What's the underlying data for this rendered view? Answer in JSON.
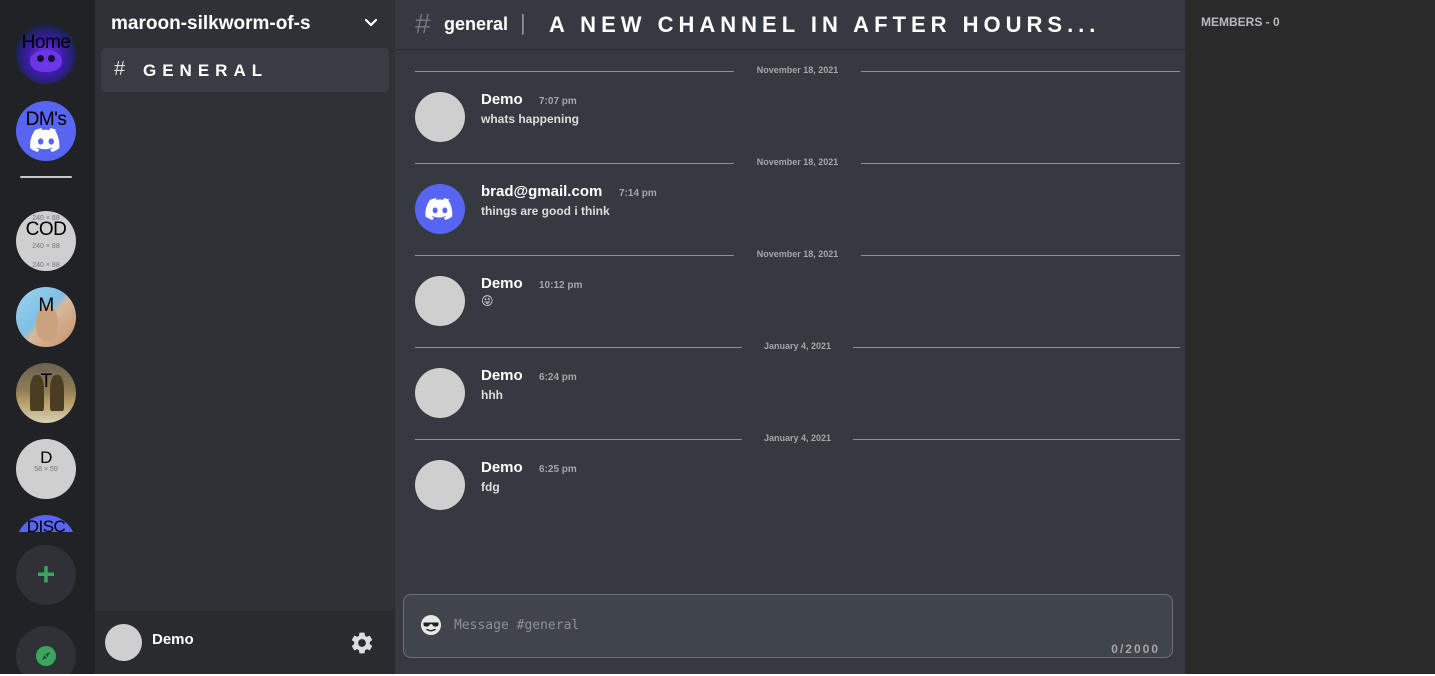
{
  "servers": {
    "home": {
      "label": "Home"
    },
    "dms": {
      "label": "DM's"
    },
    "list": [
      {
        "label": "COD",
        "sub": "240 × 88"
      },
      {
        "label": "M"
      },
      {
        "label": "T"
      },
      {
        "label": "D",
        "sub": "58 × 59"
      },
      {
        "label": "DISC"
      }
    ],
    "add_label": "+"
  },
  "guild": {
    "name": "maroon-silkworm-of-s"
  },
  "channels": [
    {
      "label": "GENERAL",
      "active": true
    }
  ],
  "user": {
    "name": "Demo"
  },
  "header": {
    "channel": "general",
    "separator": "|",
    "topic": "A NEW CHANNEL IN AFTER HOURS..."
  },
  "messages": [
    {
      "date": "November 18, 2021",
      "author": "Demo",
      "time": "7:07 pm",
      "text": "whats happening",
      "avatar": "blank"
    },
    {
      "date": "November 18, 2021",
      "author": "brad@gmail.com",
      "time": "7:14 pm",
      "text": "things are good i think",
      "avatar": "discord"
    },
    {
      "date": "November 18, 2021",
      "author": "Demo",
      "time": "10:12 pm",
      "text": "😜",
      "avatar": "blank"
    },
    {
      "date": "January 4, 2021",
      "author": "Demo",
      "time": "6:24 pm",
      "text": "hhh",
      "avatar": "blank"
    },
    {
      "date": "January 4, 2021",
      "author": "Demo",
      "time": "6:25 pm",
      "text": "fdg",
      "avatar": "blank"
    }
  ],
  "composer": {
    "placeholder": "Message #general",
    "emoji": "😎",
    "counter": "0/2000"
  },
  "members": {
    "title": "MEMBERS - 0"
  },
  "colors": {
    "rail": "#202225",
    "sidebar": "#2f3136",
    "chat": "#36393f",
    "members": "#2a2a2a",
    "blurple": "#5865f2",
    "green": "#3ba55d"
  }
}
